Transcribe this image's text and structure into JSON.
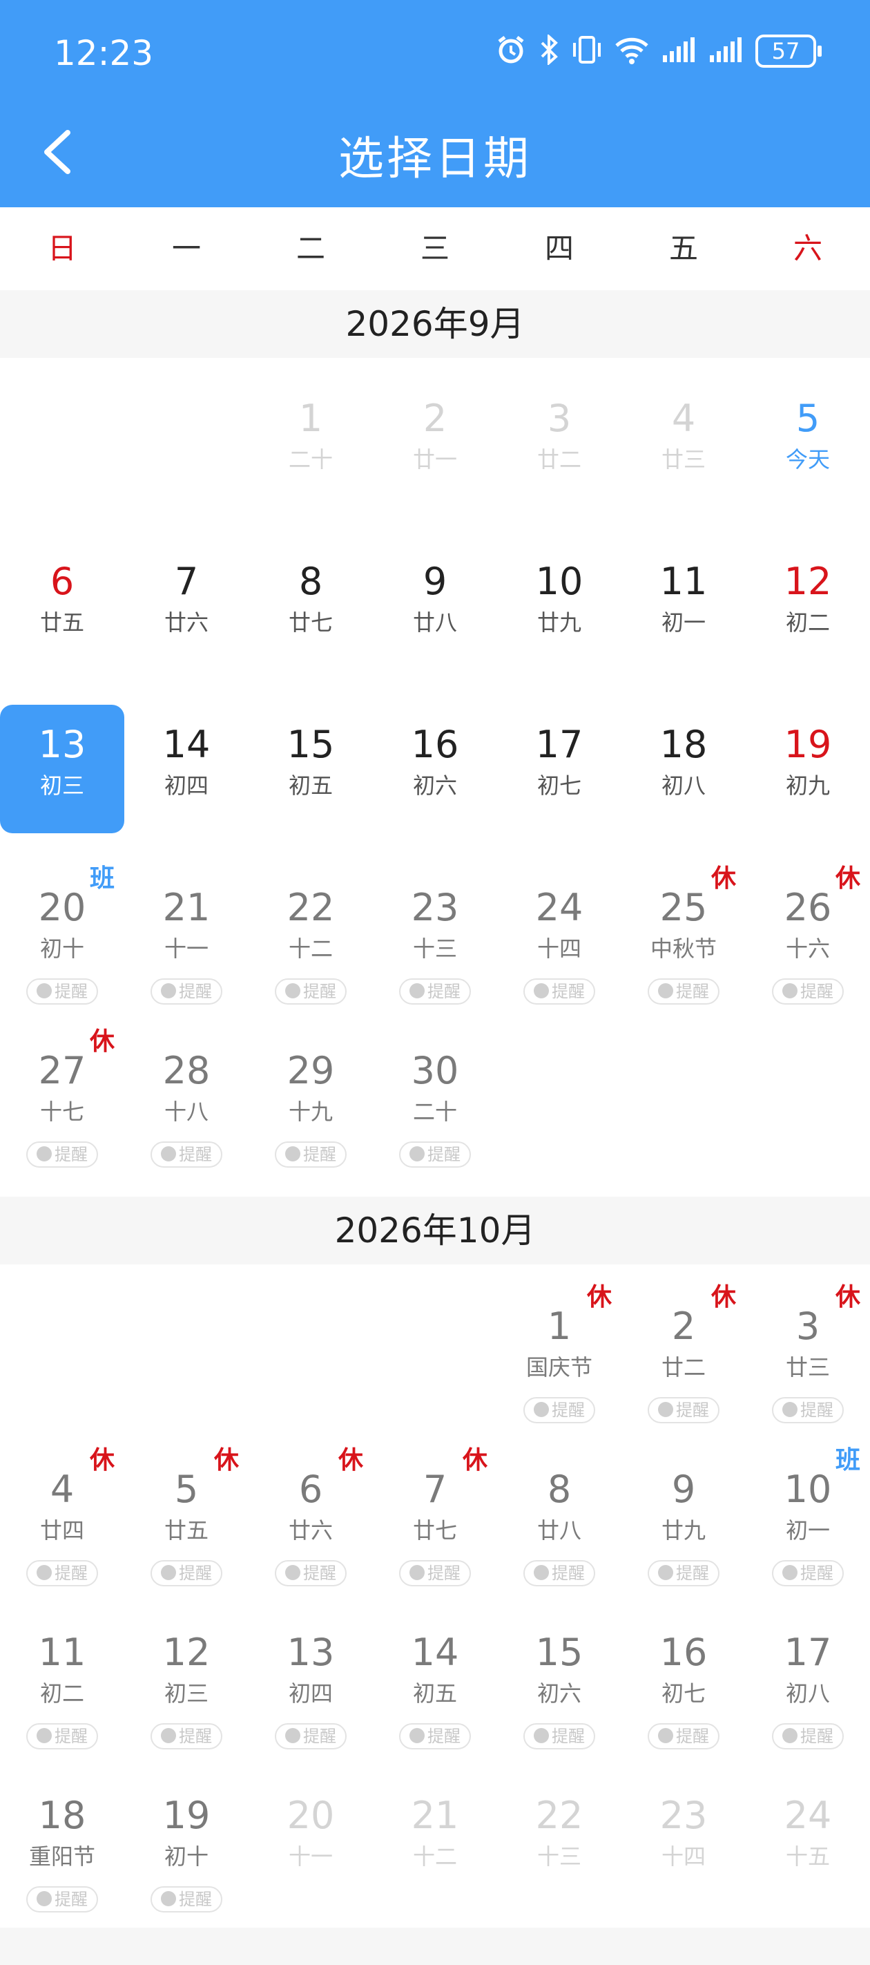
{
  "status": {
    "time": "12:23",
    "battery": "57"
  },
  "header": {
    "title": "选择日期"
  },
  "weekdays": [
    "日",
    "一",
    "二",
    "三",
    "四",
    "五",
    "六"
  ],
  "reminder_label": "提醒",
  "months": [
    {
      "title": "2026年9月",
      "days": [
        {
          "n": "1",
          "l": "二十",
          "c": 2,
          "r": 0,
          "s": "faded"
        },
        {
          "n": "2",
          "l": "廿一",
          "c": 3,
          "r": 0,
          "s": "faded"
        },
        {
          "n": "3",
          "l": "廿二",
          "c": 4,
          "r": 0,
          "s": "faded"
        },
        {
          "n": "4",
          "l": "廿三",
          "c": 5,
          "r": 0,
          "s": "faded"
        },
        {
          "n": "5",
          "l": "今天",
          "c": 6,
          "r": 0,
          "s": "today"
        },
        {
          "n": "6",
          "l": "廿五",
          "c": 0,
          "r": 1,
          "s": "black redtxt"
        },
        {
          "n": "7",
          "l": "廿六",
          "c": 1,
          "r": 1,
          "s": "black"
        },
        {
          "n": "8",
          "l": "廿七",
          "c": 2,
          "r": 1,
          "s": "black"
        },
        {
          "n": "9",
          "l": "廿八",
          "c": 3,
          "r": 1,
          "s": "black"
        },
        {
          "n": "10",
          "l": "廿九",
          "c": 4,
          "r": 1,
          "s": "black"
        },
        {
          "n": "11",
          "l": "初一",
          "c": 5,
          "r": 1,
          "s": "black"
        },
        {
          "n": "12",
          "l": "初二",
          "c": 6,
          "r": 1,
          "s": "black redtxt"
        },
        {
          "n": "13",
          "l": "初三",
          "c": 0,
          "r": 2,
          "s": "selected"
        },
        {
          "n": "14",
          "l": "初四",
          "c": 1,
          "r": 2,
          "s": "black"
        },
        {
          "n": "15",
          "l": "初五",
          "c": 2,
          "r": 2,
          "s": "black"
        },
        {
          "n": "16",
          "l": "初六",
          "c": 3,
          "r": 2,
          "s": "black"
        },
        {
          "n": "17",
          "l": "初七",
          "c": 4,
          "r": 2,
          "s": "black"
        },
        {
          "n": "18",
          "l": "初八",
          "c": 5,
          "r": 2,
          "s": "black"
        },
        {
          "n": "19",
          "l": "初九",
          "c": 6,
          "r": 2,
          "s": "black redtxt"
        },
        {
          "n": "20",
          "l": "初十",
          "c": 0,
          "r": 3,
          "s": "",
          "tag": "班",
          "tagType": "work",
          "remind": true
        },
        {
          "n": "21",
          "l": "十一",
          "c": 1,
          "r": 3,
          "s": "",
          "remind": true
        },
        {
          "n": "22",
          "l": "十二",
          "c": 2,
          "r": 3,
          "s": "",
          "remind": true
        },
        {
          "n": "23",
          "l": "十三",
          "c": 3,
          "r": 3,
          "s": "",
          "remind": true
        },
        {
          "n": "24",
          "l": "十四",
          "c": 4,
          "r": 3,
          "s": "",
          "remind": true
        },
        {
          "n": "25",
          "l": "中秋节",
          "c": 5,
          "r": 3,
          "s": "",
          "tag": "休",
          "tagType": "rest",
          "remind": true
        },
        {
          "n": "26",
          "l": "十六",
          "c": 6,
          "r": 3,
          "s": "",
          "tag": "休",
          "tagType": "rest",
          "remind": true
        },
        {
          "n": "27",
          "l": "十七",
          "c": 0,
          "r": 4,
          "s": "",
          "tag": "休",
          "tagType": "rest",
          "remind": true
        },
        {
          "n": "28",
          "l": "十八",
          "c": 1,
          "r": 4,
          "s": "",
          "remind": true
        },
        {
          "n": "29",
          "l": "十九",
          "c": 2,
          "r": 4,
          "s": "",
          "remind": true
        },
        {
          "n": "30",
          "l": "二十",
          "c": 3,
          "r": 4,
          "s": "",
          "remind": true
        }
      ]
    },
    {
      "title": "2026年10月",
      "days": [
        {
          "n": "1",
          "l": "国庆节",
          "c": 4,
          "r": 0,
          "s": "",
          "tag": "休",
          "tagType": "rest",
          "remind": true
        },
        {
          "n": "2",
          "l": "廿二",
          "c": 5,
          "r": 0,
          "s": "",
          "tag": "休",
          "tagType": "rest",
          "remind": true
        },
        {
          "n": "3",
          "l": "廿三",
          "c": 6,
          "r": 0,
          "s": "",
          "tag": "休",
          "tagType": "rest",
          "remind": true
        },
        {
          "n": "4",
          "l": "廿四",
          "c": 0,
          "r": 1,
          "s": "",
          "tag": "休",
          "tagType": "rest",
          "remind": true
        },
        {
          "n": "5",
          "l": "廿五",
          "c": 1,
          "r": 1,
          "s": "",
          "tag": "休",
          "tagType": "rest",
          "remind": true
        },
        {
          "n": "6",
          "l": "廿六",
          "c": 2,
          "r": 1,
          "s": "",
          "tag": "休",
          "tagType": "rest",
          "remind": true
        },
        {
          "n": "7",
          "l": "廿七",
          "c": 3,
          "r": 1,
          "s": "",
          "tag": "休",
          "tagType": "rest",
          "remind": true
        },
        {
          "n": "8",
          "l": "廿八",
          "c": 4,
          "r": 1,
          "s": "",
          "remind": true
        },
        {
          "n": "9",
          "l": "廿九",
          "c": 5,
          "r": 1,
          "s": "",
          "remind": true
        },
        {
          "n": "10",
          "l": "初一",
          "c": 6,
          "r": 1,
          "s": "",
          "tag": "班",
          "tagType": "work",
          "remind": true
        },
        {
          "n": "11",
          "l": "初二",
          "c": 0,
          "r": 2,
          "s": "",
          "remind": true
        },
        {
          "n": "12",
          "l": "初三",
          "c": 1,
          "r": 2,
          "s": "",
          "remind": true
        },
        {
          "n": "13",
          "l": "初四",
          "c": 2,
          "r": 2,
          "s": "",
          "remind": true
        },
        {
          "n": "14",
          "l": "初五",
          "c": 3,
          "r": 2,
          "s": "",
          "remind": true
        },
        {
          "n": "15",
          "l": "初六",
          "c": 4,
          "r": 2,
          "s": "",
          "remind": true
        },
        {
          "n": "16",
          "l": "初七",
          "c": 5,
          "r": 2,
          "s": "",
          "remind": true
        },
        {
          "n": "17",
          "l": "初八",
          "c": 6,
          "r": 2,
          "s": "",
          "remind": true
        },
        {
          "n": "18",
          "l": "重阳节",
          "c": 0,
          "r": 3,
          "s": "",
          "remind": true
        },
        {
          "n": "19",
          "l": "初十",
          "c": 1,
          "r": 3,
          "s": "",
          "remind": true
        },
        {
          "n": "20",
          "l": "十一",
          "c": 2,
          "r": 3,
          "s": "faded"
        },
        {
          "n": "21",
          "l": "十二",
          "c": 3,
          "r": 3,
          "s": "faded"
        },
        {
          "n": "22",
          "l": "十三",
          "c": 4,
          "r": 3,
          "s": "faded"
        },
        {
          "n": "23",
          "l": "十四",
          "c": 5,
          "r": 3,
          "s": "faded"
        },
        {
          "n": "24",
          "l": "十五",
          "c": 6,
          "r": 3,
          "s": "faded"
        }
      ]
    }
  ]
}
